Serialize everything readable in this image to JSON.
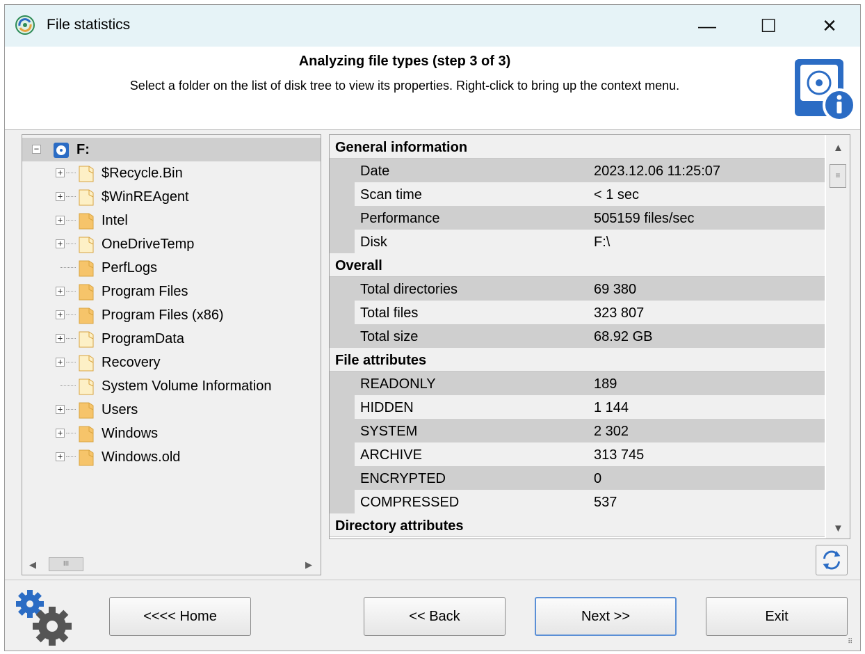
{
  "window": {
    "title": "File statistics",
    "minimize": "—",
    "maximize": "☐",
    "close": "✕"
  },
  "header": {
    "title": "Analyzing file types (step 3 of 3)",
    "subtitle": "Select a folder on the list of disk tree to view its properties. Right-click to bring up the context menu."
  },
  "tree": {
    "root": {
      "label": "F:",
      "expander": "−"
    },
    "items": [
      {
        "label": "$Recycle.Bin",
        "expandable": true,
        "folder_color": "#fdf0c6"
      },
      {
        "label": "$WinREAgent",
        "expandable": true,
        "folder_color": "#fdf0c6"
      },
      {
        "label": "Intel",
        "expandable": true,
        "folder_color": "#f6c46a"
      },
      {
        "label": "OneDriveTemp",
        "expandable": true,
        "folder_color": "#fdf0c6"
      },
      {
        "label": "PerfLogs",
        "expandable": false,
        "folder_color": "#f6c46a"
      },
      {
        "label": "Program Files",
        "expandable": true,
        "folder_color": "#f6c46a"
      },
      {
        "label": "Program Files (x86)",
        "expandable": true,
        "folder_color": "#f6c46a"
      },
      {
        "label": "ProgramData",
        "expandable": true,
        "folder_color": "#fdf0c6"
      },
      {
        "label": "Recovery",
        "expandable": true,
        "folder_color": "#fdf0c6"
      },
      {
        "label": "System Volume Information",
        "expandable": false,
        "folder_color": "#fdf0c6"
      },
      {
        "label": "Users",
        "expandable": true,
        "folder_color": "#f6c46a"
      },
      {
        "label": "Windows",
        "expandable": true,
        "folder_color": "#f6c46a"
      },
      {
        "label": "Windows.old",
        "expandable": true,
        "folder_color": "#f6c46a"
      }
    ],
    "expander_plus": "+",
    "hscroll": {
      "left": "◀",
      "right": "▶",
      "thumb": "III"
    }
  },
  "properties": {
    "groups": [
      {
        "title": "General information",
        "rows": [
          {
            "key": "Date",
            "value": "2023.12.06 11:25:07"
          },
          {
            "key": "Scan time",
            "value": "< 1 sec"
          },
          {
            "key": "Performance",
            "value": "505159 files/sec"
          },
          {
            "key": "Disk",
            "value": "F:\\"
          }
        ]
      },
      {
        "title": "Overall",
        "rows": [
          {
            "key": "Total directories",
            "value": "69 380"
          },
          {
            "key": "Total files",
            "value": "323 807"
          },
          {
            "key": "Total size",
            "value": "68.92 GB"
          }
        ]
      },
      {
        "title": "File attributes",
        "rows": [
          {
            "key": "READONLY",
            "value": "189"
          },
          {
            "key": "HIDDEN",
            "value": "1 144"
          },
          {
            "key": "SYSTEM",
            "value": "2 302"
          },
          {
            "key": "ARCHIVE",
            "value": "313 745"
          },
          {
            "key": "ENCRYPTED",
            "value": "0"
          },
          {
            "key": "COMPRESSED",
            "value": "537"
          }
        ]
      },
      {
        "title": "Directory attributes",
        "rows": []
      }
    ],
    "scroll": {
      "up": "▲",
      "down": "▼",
      "thumb": "≡"
    }
  },
  "buttons": {
    "home": "<<<< Home",
    "back": "<< Back",
    "next": "Next >>",
    "exit": "Exit"
  },
  "colors": {
    "accent": "#2b6cc4",
    "folder_dark": "#f6c46a",
    "folder_light": "#fdf0c6",
    "selection_gray": "#cfcfcf"
  }
}
